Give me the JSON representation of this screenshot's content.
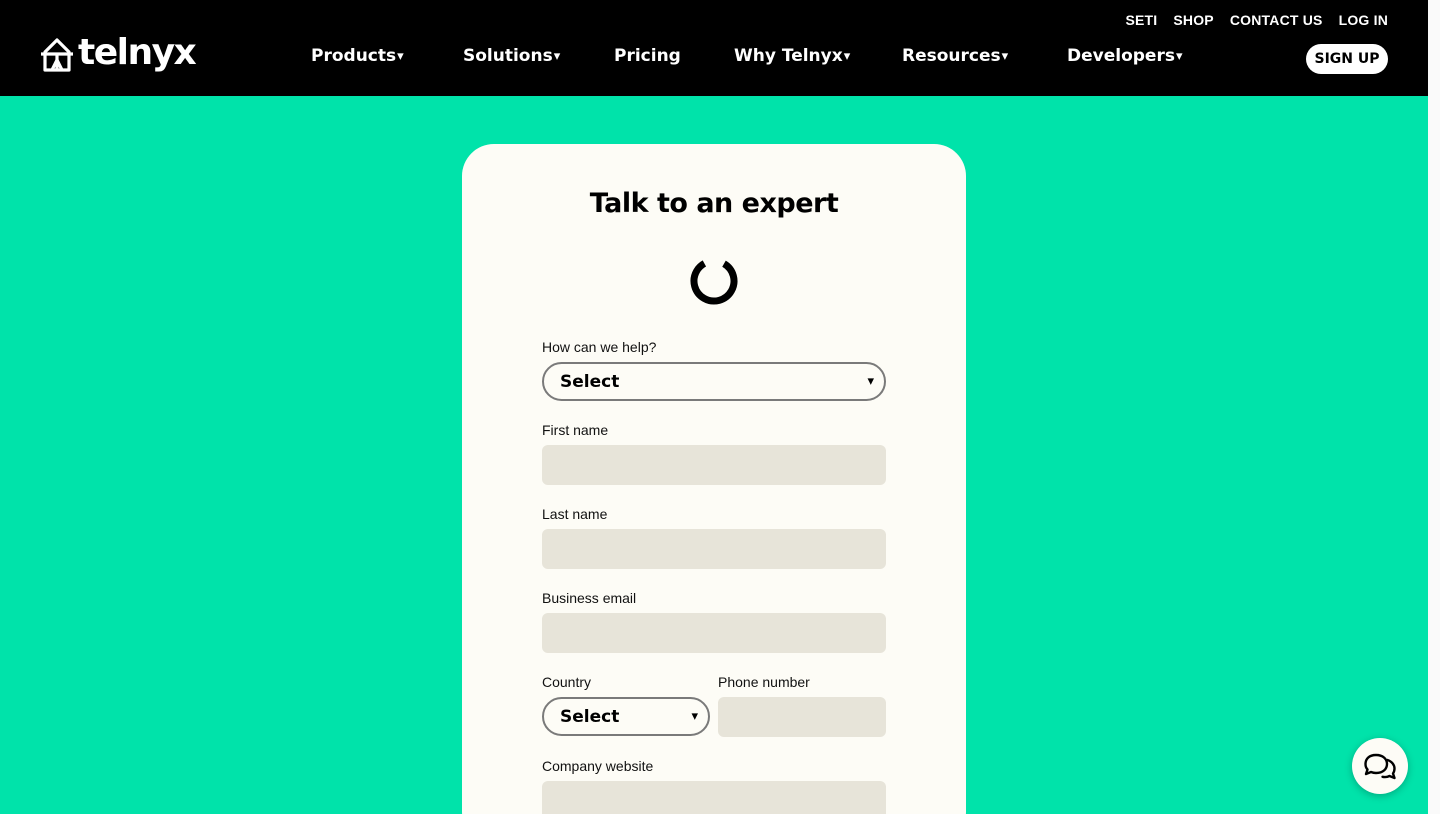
{
  "header": {
    "logo_text": "telnyx",
    "utility_links": [
      "SETI",
      "SHOP",
      "CONTACT US",
      "LOG IN"
    ],
    "nav": [
      {
        "label": "Products",
        "has_caret": true
      },
      {
        "label": "Solutions",
        "has_caret": true
      },
      {
        "label": "Pricing",
        "has_caret": false
      },
      {
        "label": "Why Telnyx",
        "has_caret": true
      },
      {
        "label": "Resources",
        "has_caret": true
      },
      {
        "label": "Developers",
        "has_caret": true
      }
    ],
    "caret": "▾",
    "signup_label": "SIGN UP"
  },
  "form": {
    "title": "Talk to an expert",
    "help": {
      "label": "How can we help?",
      "value": "Select"
    },
    "first_name": {
      "label": "First name",
      "value": ""
    },
    "last_name": {
      "label": "Last name",
      "value": ""
    },
    "email": {
      "label": "Business email",
      "value": ""
    },
    "country": {
      "label": "Country",
      "value": "Select"
    },
    "phone": {
      "label": "Phone number",
      "value": ""
    },
    "website": {
      "label": "Company website",
      "value": ""
    },
    "select_arrow": "▾"
  },
  "colors": {
    "page_bg": "#00e3aa",
    "header_bg": "#000000",
    "card_bg": "#fdfcf6",
    "input_bg": "#e7e4d9"
  },
  "icons": {
    "logo": "telnyx-logo-icon",
    "spinner": "loading-spinner-icon",
    "chat": "chat-bubbles-icon"
  }
}
